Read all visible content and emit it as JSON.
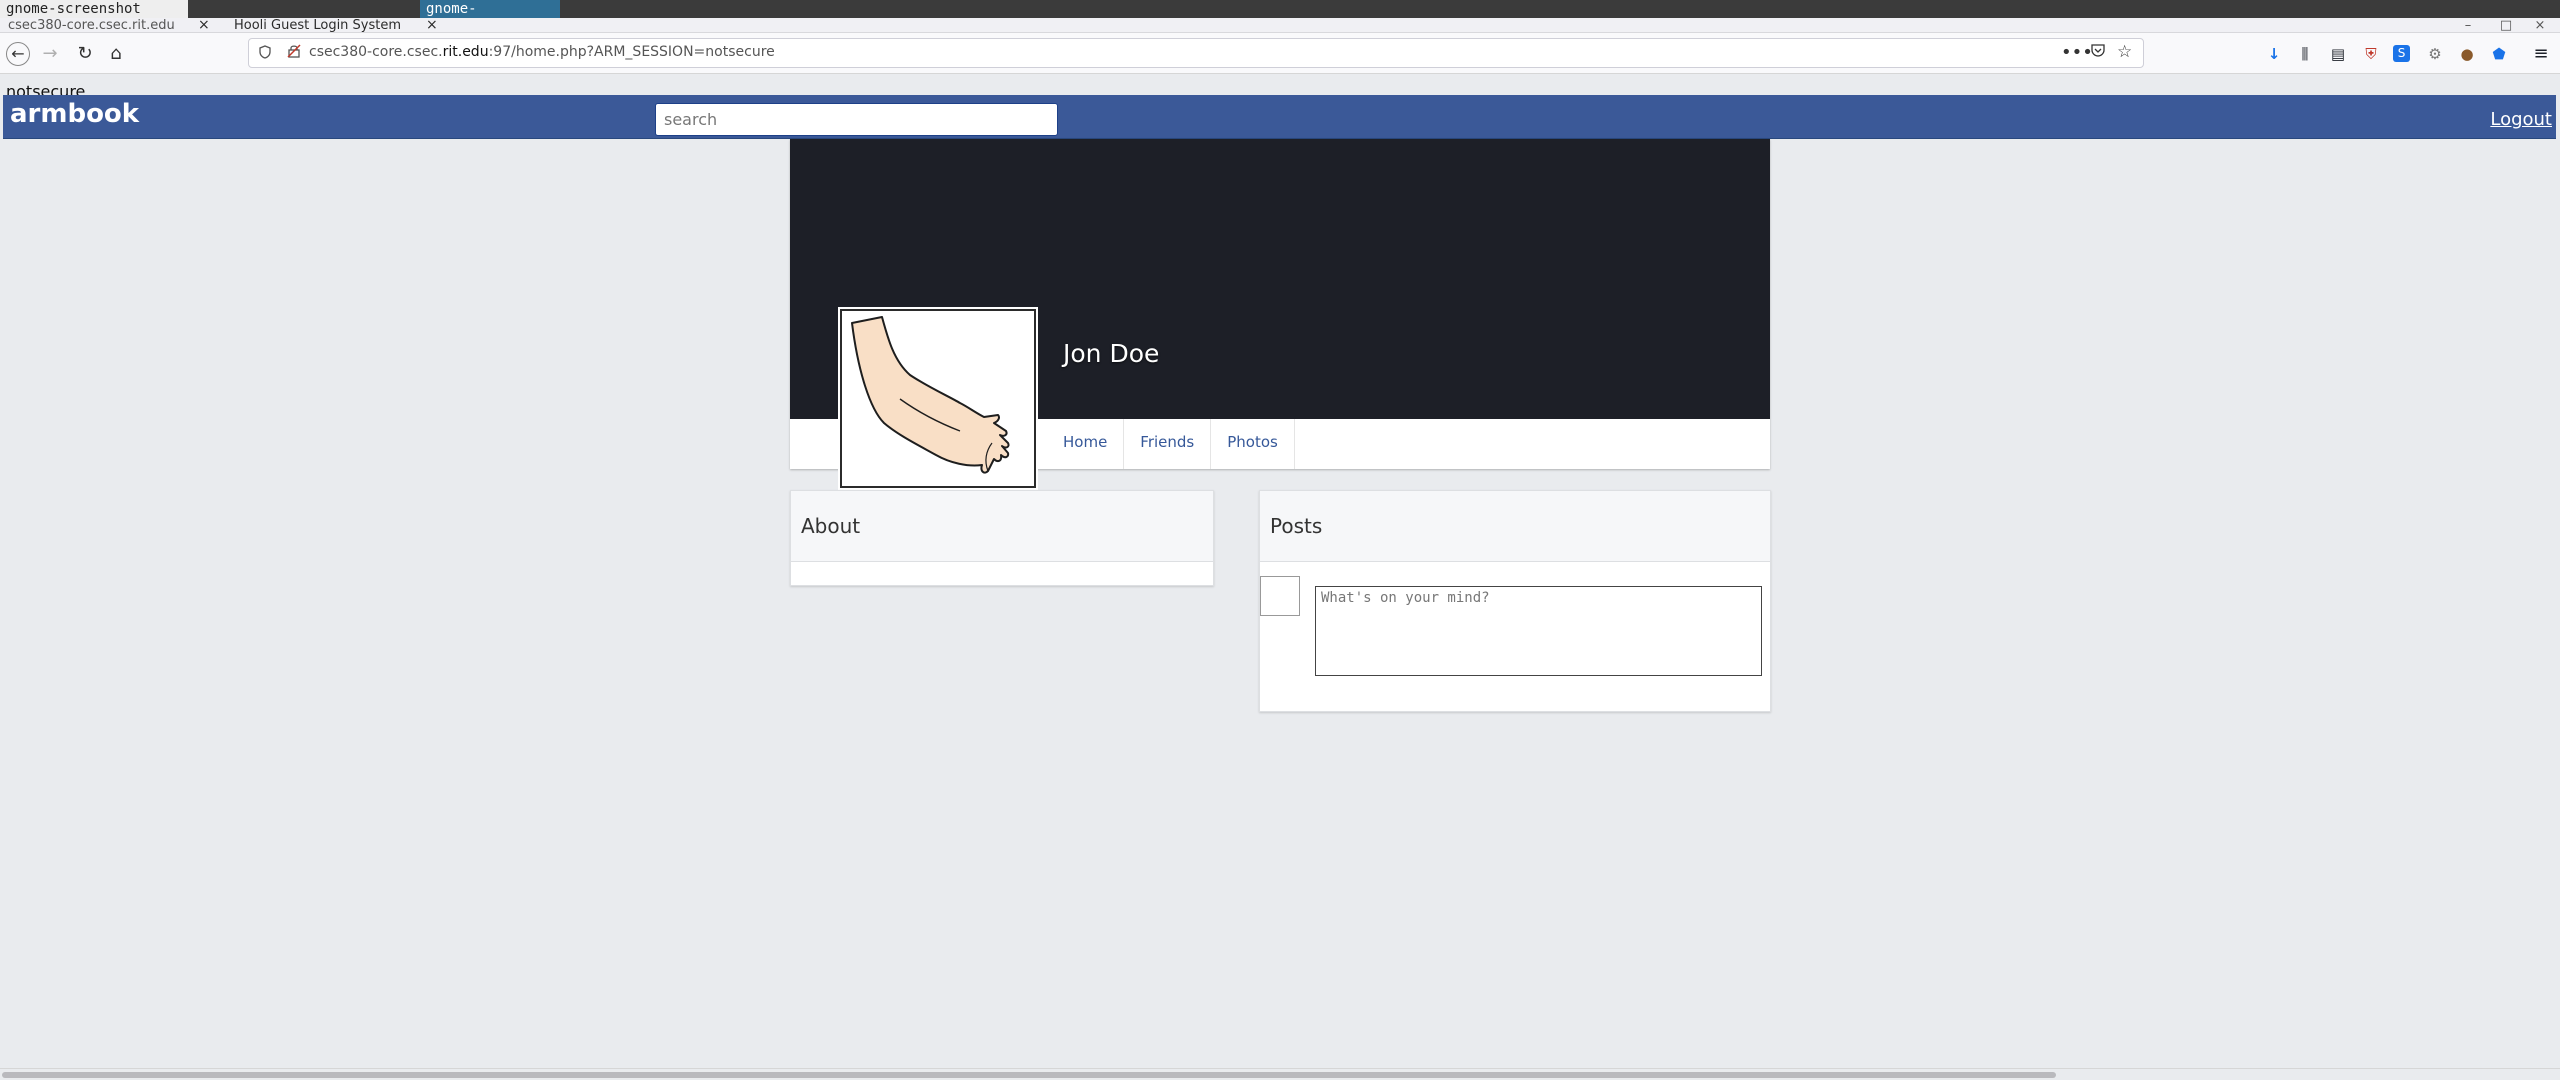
{
  "system": {
    "tab_1": "gnome-screenshot",
    "tab_2": "gnome-screenshot"
  },
  "browser": {
    "tabs": [
      {
        "label": "csec380-core.csec.rit.edu",
        "close": "×"
      },
      {
        "label": "Hooli Guest Login System",
        "close": "×"
      }
    ],
    "window_controls": {
      "minimize": "–",
      "maximize": "□",
      "close": "×"
    },
    "url": {
      "prefix": "csec380-core.csec.",
      "domain": "rit.edu",
      "suffix": ":97/home.php?ARM_SESSION=notsecure"
    },
    "nav_icons": {
      "back": "←",
      "forward": "→",
      "reload": "↻",
      "home": "⌂"
    },
    "toolbar_icons": {
      "more": "•••",
      "pocket": "◙",
      "star": "☆",
      "download": "↓",
      "library": "⫼",
      "sidebar": "▤",
      "ublock": "⛨",
      "ext_s": "S",
      "ext_gear": "⚙",
      "ext_cookie": "●",
      "ext_shield": "⬟",
      "menu": "≡"
    },
    "accent_download": "#1a73e8"
  },
  "page": {
    "notice": "notsecure",
    "header": {
      "logo": "armbook",
      "search_placeholder": "search",
      "logout": "Logout",
      "color": "#3b5998"
    },
    "profile": {
      "name": "Jon Doe",
      "cover_color": "#1d1f27",
      "nav": [
        "Home",
        "Friends",
        "Photos"
      ]
    },
    "about": {
      "title": "About"
    },
    "posts": {
      "title": "Posts",
      "placeholder": "What's on your mind?"
    }
  }
}
